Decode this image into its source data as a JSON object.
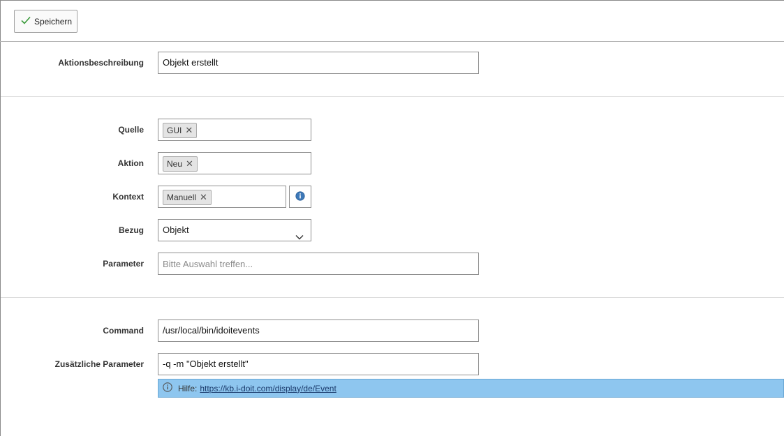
{
  "toolbar": {
    "save_label": "Speichern"
  },
  "form": {
    "description": {
      "label": "Aktionsbeschreibung",
      "value": "Objekt erstellt"
    },
    "source": {
      "label": "Quelle",
      "chip": "GUI"
    },
    "action": {
      "label": "Aktion",
      "chip": "Neu"
    },
    "context": {
      "label": "Kontext",
      "chip": "Manuell"
    },
    "reference": {
      "label": "Bezug",
      "value": "Objekt"
    },
    "parameter": {
      "label": "Parameter",
      "placeholder": "Bitte Auswahl treffen..."
    },
    "command": {
      "label": "Command",
      "value": "/usr/local/bin/idoitevents"
    },
    "extra_params": {
      "label": "Zusätzliche Parameter",
      "value": "-q -m \"Objekt erstellt\""
    }
  },
  "help": {
    "prefix": "Hilfe:",
    "link": "https://kb.i-doit.com/display/de/Event"
  },
  "colors": {
    "help_bg": "#8ec6ef",
    "check": "#3a9a3a",
    "info_icon": "#3d78b8"
  },
  "icons": {
    "save": "check-icon",
    "remove": "close-icon",
    "info": "info-icon",
    "dropdown": "chevron-down-icon"
  }
}
